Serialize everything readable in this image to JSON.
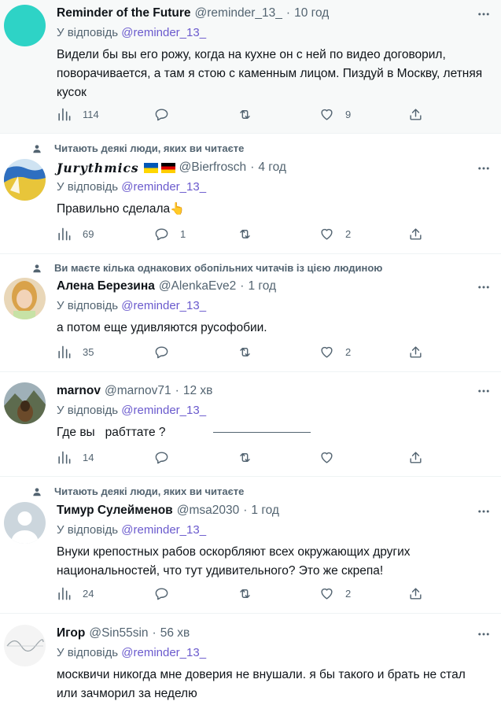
{
  "tweets": [
    {
      "name": "Reminder of the Future",
      "handle": "@reminder_13_",
      "time": "10 год",
      "reply_prefix": "У відповідь",
      "reply_to": "@reminder_13_",
      "text": "Видели бы вы его рожу, когда на кухне он с ней по видео договорил, поворачивается, а там я стою с каменным лицом. Пиздуй в Москву, летняя кусок",
      "views": "114",
      "replies": "",
      "retweets": "",
      "likes": "9",
      "avatar_color": "#2ed3c6"
    },
    {
      "social_context": "Читають деякі люди, яких ви читаєте",
      "name": "Jurythmics",
      "handle": "@Bierfrosch",
      "time": "4 год",
      "reply_prefix": "У відповідь",
      "reply_to": "@reminder_13_",
      "text": "Правильно сделала",
      "emoji": "👆",
      "views": "69",
      "replies": "1",
      "retweets": "",
      "likes": "2"
    },
    {
      "social_context": "Ви маєте кілька однакових обопільних читачів із цією людиною",
      "name": "Алена Березина",
      "handle": "@AlenkaEve2",
      "time": "1 год",
      "reply_prefix": "У відповідь",
      "reply_to": "@reminder_13_",
      "text": "а потом еще удивляются русофобии.",
      "views": "35",
      "replies": "",
      "retweets": "",
      "likes": "2"
    },
    {
      "name": "marnov",
      "handle": "@marnov71",
      "time": "12 хв",
      "reply_prefix": "У відповідь",
      "reply_to": "@reminder_13_",
      "text": "Где вы   рабттате ?",
      "views": "14",
      "replies": "",
      "retweets": "",
      "likes": ""
    },
    {
      "social_context": "Читають деякі люди, яких ви читаєте",
      "name": "Тимур Сулейменов",
      "handle": "@msa2030",
      "time": "1 год",
      "reply_prefix": "У відповідь",
      "reply_to": "@reminder_13_",
      "text": "Внуки крепостных рабов оскорбляют всех окружающих других национальностей, что тут удивительного? Это же скрепа!",
      "views": "24",
      "replies": "",
      "retweets": "",
      "likes": "2"
    },
    {
      "name": "Игор",
      "handle": "@Sin55sin",
      "time": "56 хв",
      "reply_prefix": "У відповідь",
      "reply_to": "@reminder_13_",
      "text": "москвичи никогда мне доверия не внушали. я бы такого и брать не стал или зачморил за неделю"
    }
  ],
  "separator_dot": "·",
  "colors": {
    "text_primary": "#0f1419",
    "text_secondary": "#536471",
    "mention": "#6a5acd",
    "highlight_bg": "#f7f9f9"
  },
  "icons": [
    "person-icon",
    "more-icon",
    "views-icon",
    "reply-icon",
    "retweet-icon",
    "like-icon",
    "share-icon"
  ]
}
